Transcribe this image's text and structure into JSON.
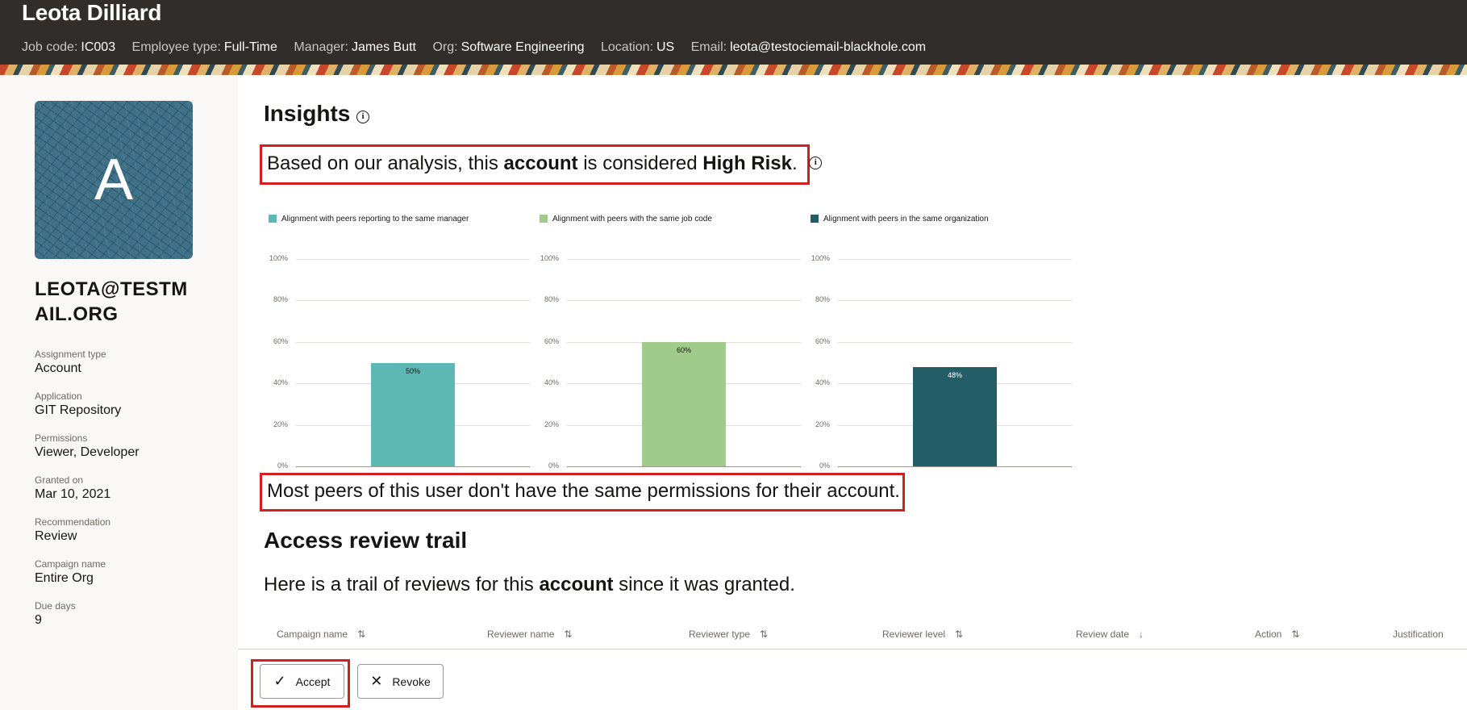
{
  "header": {
    "name": "Leota Dilliard",
    "meta": [
      {
        "label": "Job code:",
        "value": "IC003"
      },
      {
        "label": "Employee type:",
        "value": "Full-Time"
      },
      {
        "label": "Manager:",
        "value": "James Butt"
      },
      {
        "label": "Org:",
        "value": "Software Engineering"
      },
      {
        "label": "Location:",
        "value": "US"
      },
      {
        "label": "Email:",
        "value": "leota@testociemail-blackhole.com"
      }
    ]
  },
  "sidebar": {
    "avatar_letter": "A",
    "user_id": "LEOTA@TESTMAIL.ORG",
    "details": [
      {
        "label": "Assignment type",
        "value": "Account"
      },
      {
        "label": "Application",
        "value": "GIT Repository"
      },
      {
        "label": "Permissions",
        "value": "Viewer, Developer"
      },
      {
        "label": "Granted on",
        "value": "Mar 10, 2021"
      },
      {
        "label": "Recommendation",
        "value": "Review"
      },
      {
        "label": "Campaign name",
        "value": "Entire Org"
      },
      {
        "label": "Due days",
        "value": "9"
      }
    ]
  },
  "insights": {
    "title": "Insights",
    "risk_prefix": "Based on our analysis, this",
    "risk_entity": "account",
    "risk_middle": "is considered",
    "risk_level": "High Risk",
    "risk_suffix": ".",
    "peer_summary": "Most peers of this user don't have the same permissions for their account."
  },
  "chart_data": [
    {
      "type": "bar",
      "legend": "Alignment with peers reporting to the same manager",
      "color": "#5db7b5",
      "values": [
        50
      ],
      "value_label": "50%",
      "label_color": "#161513",
      "y_ticks": [
        "100%",
        "80%",
        "60%",
        "40%",
        "20%",
        "0%"
      ],
      "ylim": [
        0,
        100
      ]
    },
    {
      "type": "bar",
      "legend": "Alignment with peers with the same job code",
      "color": "#a0cb8b",
      "values": [
        60
      ],
      "value_label": "60%",
      "label_color": "#161513",
      "y_ticks": [
        "100%",
        "80%",
        "60%",
        "40%",
        "20%",
        "0%"
      ],
      "ylim": [
        0,
        100
      ]
    },
    {
      "type": "bar",
      "legend": "Alignment with peers in the same organization",
      "color": "#235e68",
      "values": [
        48
      ],
      "value_label": "48%",
      "label_color": "#ffffff",
      "y_ticks": [
        "100%",
        "80%",
        "60%",
        "40%",
        "20%",
        "0%"
      ],
      "ylim": [
        0,
        100
      ]
    }
  ],
  "trail": {
    "title": "Access review trail",
    "desc_prefix": "Here is a trail of reviews for this",
    "desc_entity": "account",
    "desc_suffix": "since it was granted.",
    "columns": [
      {
        "label": "Campaign name",
        "sort": "⇅"
      },
      {
        "label": "Reviewer name",
        "sort": "⇅"
      },
      {
        "label": "Reviewer type",
        "sort": "⇅"
      },
      {
        "label": "Reviewer level",
        "sort": "⇅"
      },
      {
        "label": "Review date",
        "sort": "↓"
      },
      {
        "label": "Action",
        "sort": "⇅"
      },
      {
        "label": "Justification",
        "sort": ""
      }
    ]
  },
  "actions": {
    "accept_label": "Accept",
    "accept_icon": "check-icon",
    "revoke_label": "Revoke",
    "revoke_icon": "close-icon"
  }
}
